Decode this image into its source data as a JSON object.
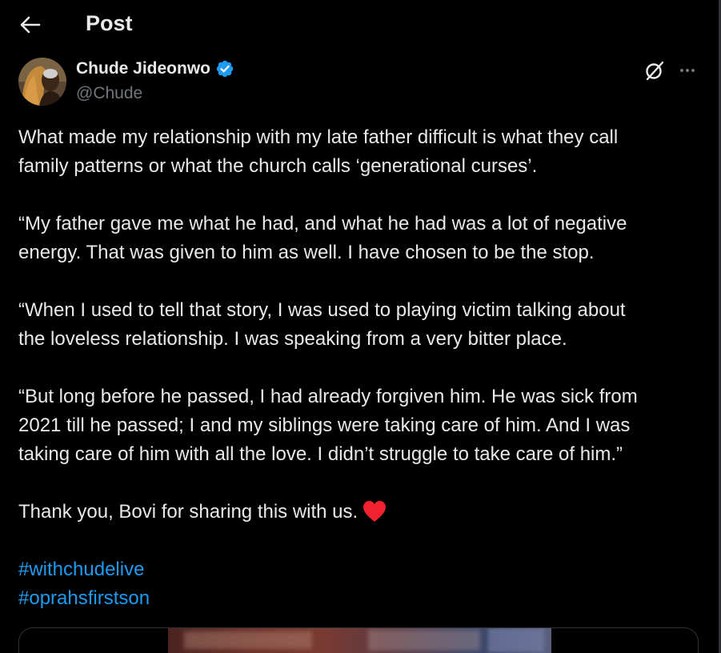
{
  "header": {
    "title": "Post"
  },
  "author": {
    "name": "Chude Jideonwo",
    "handle": "@Chude"
  },
  "tweet": {
    "paragraphs": [
      "What made my relationship with my late father difficult is what they call\nfamily patterns or what the church calls ‘generational curses’.",
      "“My father gave me what he had, and what he had was a lot of negative\nenergy. That was given to him as well. I have chosen to be the stop.",
      "“When I used to tell that story, I was used to playing victim talking about\nthe loveless relationship. I was speaking from a very bitter place.",
      "“But long before he passed, I had already forgiven him. He was sick from\n2021 till he passed; I and my siblings were taking care of him. And I was\ntaking care of him with all the love. I didn’t struggle to take care of him.”",
      "Thank you, Bovi for sharing this with us."
    ],
    "hashtags": [
      "#withchudelive",
      "#oprahsfirstson"
    ]
  },
  "colors": {
    "background": "#000000",
    "text": "#e7e9ea",
    "secondary_text": "#71767b",
    "link": "#1d9bf0",
    "verified": "#1d9bf0",
    "heart": "#f4212e",
    "border": "#2f3336"
  },
  "icons": {
    "back": "arrow-left-icon",
    "verified": "verified-badge-icon",
    "grok": "grok-icon",
    "more": "more-dots-icon",
    "heart": "red-heart-emoji"
  }
}
